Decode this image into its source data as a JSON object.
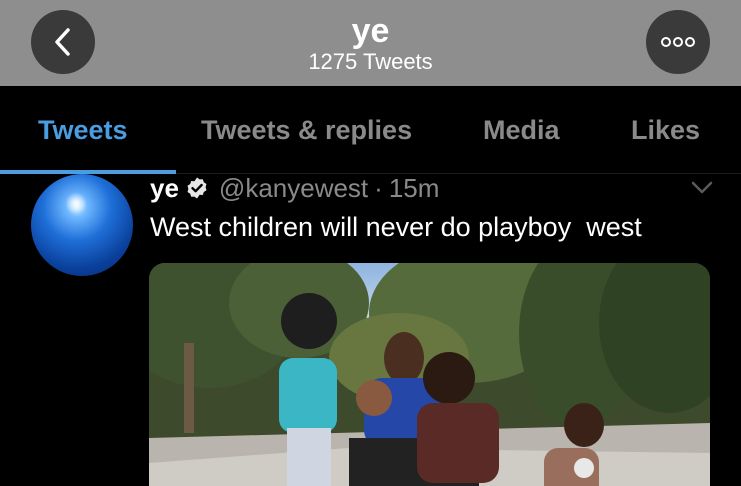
{
  "header": {
    "title": "ye",
    "subtitle": "1275 Tweets"
  },
  "tabs": [
    {
      "label": "Tweets",
      "active": true
    },
    {
      "label": "Tweets & replies",
      "active": false
    },
    {
      "label": "Media",
      "active": false
    },
    {
      "label": "Likes",
      "active": false
    }
  ],
  "tweet": {
    "display_name": "ye",
    "handle": "@kanyewest",
    "separator": "·",
    "time": "15m",
    "text": "West children will never do playboy  west"
  },
  "colors": {
    "accent": "#4a9de0",
    "header_bg": "#8e8e8e",
    "background": "#000000",
    "muted_text": "#8a8a8a"
  },
  "icons": [
    "back-arrow-icon",
    "more-options-icon",
    "verified-badge-icon",
    "chevron-down-icon"
  ]
}
